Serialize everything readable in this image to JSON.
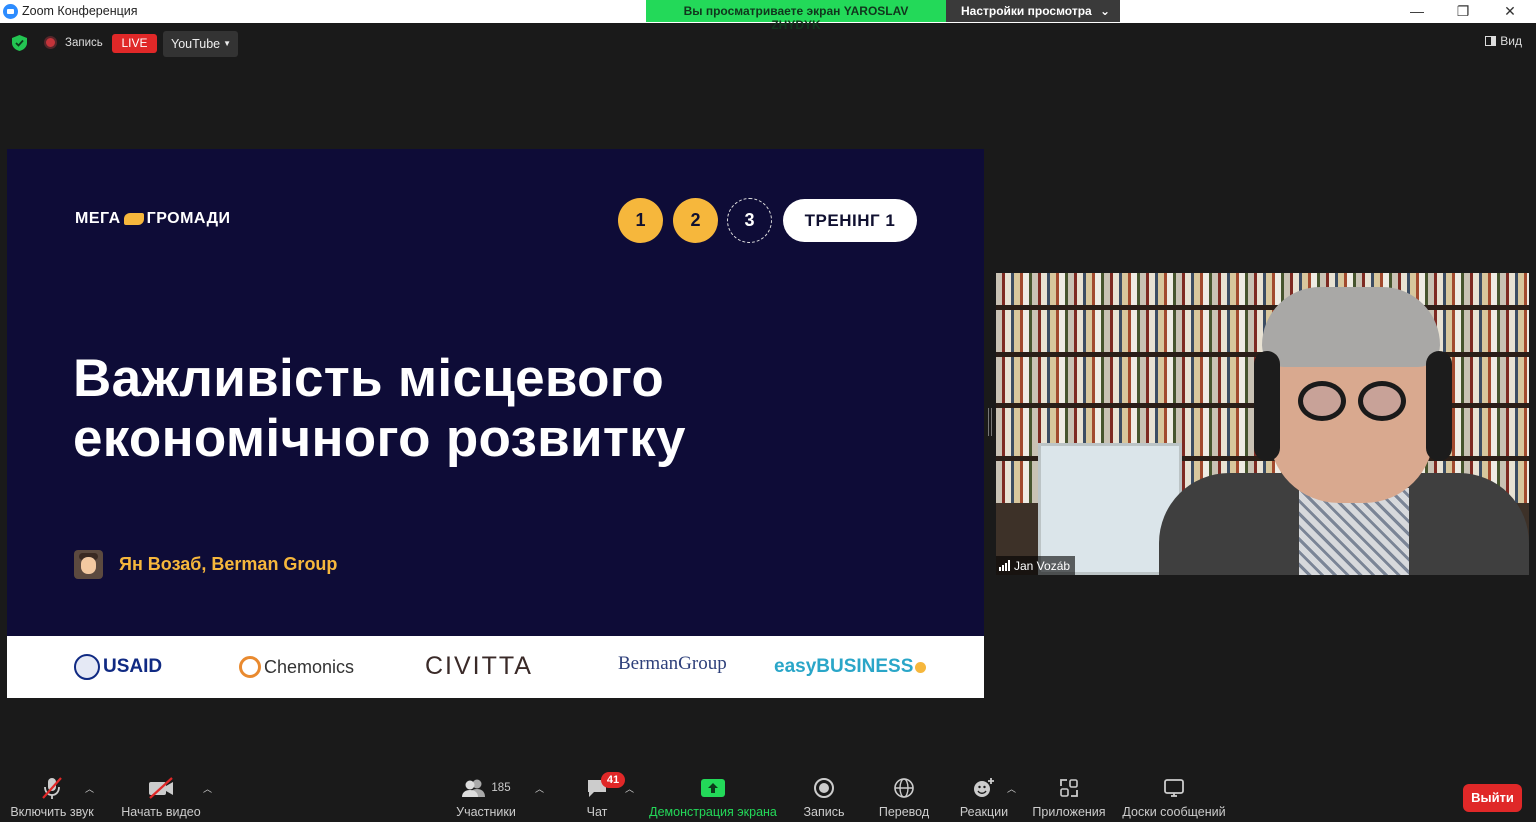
{
  "window": {
    "title": "Zoom Конференция",
    "share_banner": "Вы просматриваете экран YAROSLAV ZHYDYK",
    "view_options": "Настройки просмотра"
  },
  "top_bar": {
    "recording": "Запись",
    "live": "LIVE",
    "stream_target": "YouTube",
    "view": "Вид"
  },
  "slide": {
    "brand_left": "МЕГА",
    "brand_right": "ГРОМАДИ",
    "steps": [
      "1",
      "2",
      "3"
    ],
    "training": "ТРЕНІНГ 1",
    "title_line1": "Важливість місцевого",
    "title_line2": "економічного розвитку",
    "presenter": "Ян Возаб, Berman Group",
    "logos": {
      "usaid": "USAID",
      "chemonics": "Chemonics",
      "civitta": "CIVITTA",
      "berman": "BermanGroup",
      "easybusiness": "easyBUSINESS"
    },
    "colors": {
      "background": "#0e0c37",
      "accent": "#f6b73c"
    }
  },
  "video": {
    "participant_name": "Jan Vozáb"
  },
  "toolbar": {
    "unmute": "Включить звук",
    "start_video": "Начать видео",
    "participants": "Участники",
    "participants_count": "185",
    "chat": "Чат",
    "chat_badge": "41",
    "share_screen": "Демонстрация экрана",
    "record": "Запись",
    "translate": "Перевод",
    "reactions": "Реакции",
    "apps": "Приложения",
    "whiteboards": "Доски сообщений",
    "leave": "Выйти"
  }
}
